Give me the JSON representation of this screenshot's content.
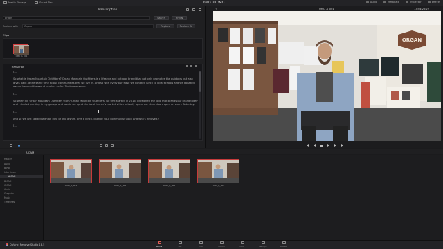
{
  "topbar": {
    "tabs": [
      "Media Storage",
      "Sound Tab"
    ],
    "project_title": "OMO PROMO",
    "right_items": [
      "Audio",
      "Metadata",
      "Inspector",
      "Effects"
    ]
  },
  "transcription_panel": {
    "title": "Transcription",
    "search": {
      "value": "organ",
      "search_button": "Search",
      "find_button": "Find N"
    },
    "replace": {
      "label": "Replace with",
      "value": "Organ",
      "replace_button": "Replace",
      "replace_all_button": "Replace All"
    },
    "clips_label": "Clips",
    "selected_clip": "OMO_A_001",
    "transcript_label": "Transcript",
    "paragraphs": [
      "[...]",
      "So what is Organ Mountain Outfitters? Organ Mountain Outfitters is a lifestyle and outdoor brand that not only promotes the outdoors but also gives back at the same time to our communities that we live in. And so with every purchase we donated lunch to local schools and we donated over a hundred thousand lunches so far. That's awesome.",
      "[...]",
      "So when did Organ Mountain Outfitters start? Organ Mountain Outfitters, we first started in 2016. I designed the logo that brands our brand today and I started printing in my garage and would set up at the local farmer's market which actually opens our store doors open on every Saturday.",
      "[...]",
      "And so we just started with an idea of buy a shirt, give a lunch, change your community. Cool. And who's involved?",
      "[...]"
    ]
  },
  "viewer": {
    "zoom": "Fit",
    "clip_name": "OMO_A_001",
    "timecode": "13:44:25:22",
    "sign_text": "ORGAN"
  },
  "media_pool": {
    "title": "A CAM",
    "bins": [
      "Master",
      "Audio",
      "B-Roll",
      "Interviews",
      "A CAM",
      "B CAM",
      "C CAM",
      "Audio",
      "Graphics",
      "Music",
      "Timelines"
    ],
    "selected_bin_index": 4,
    "clips": [
      "OMO_A_001",
      "OMO_A_002",
      "OMO_A_003",
      "OMO_A_004"
    ]
  },
  "app": {
    "brand": "DaVinci Resolve Studio 18.5",
    "pages": [
      "Media",
      "Cut",
      "Edit",
      "Fusion",
      "Color",
      "Fairlight",
      "Deliver"
    ],
    "active_page_index": 0
  },
  "colors": {
    "accent": "#e35f57",
    "selection": "#c63b3b"
  }
}
